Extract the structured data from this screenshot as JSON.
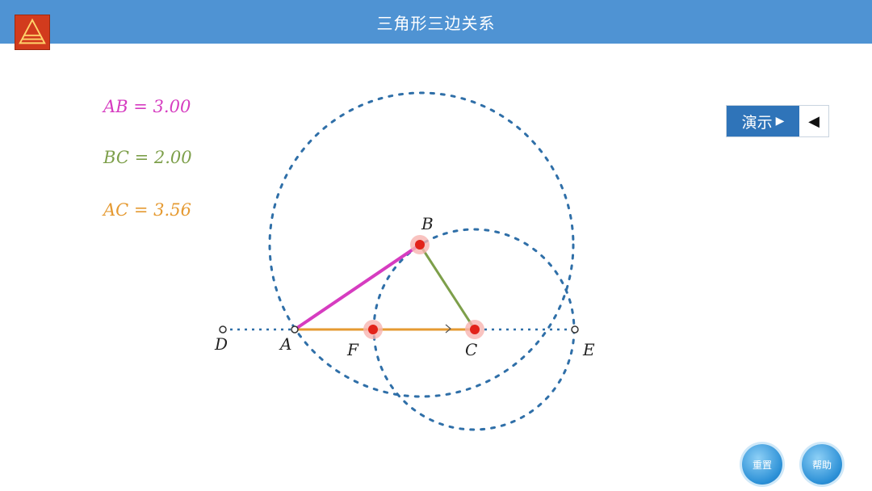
{
  "app": {
    "title": "三角形三边关系"
  },
  "colors": {
    "titlebar": "#4f93d3",
    "ab": "#d63cc0",
    "bc": "#7d9f4a",
    "ac": "#e59a32",
    "circle": "#2f6fa8",
    "point": "#e2231a"
  },
  "measurements": {
    "ab": "AB = 3.00",
    "bc": "BC = 2.00",
    "ac": "AC = 3.56"
  },
  "controls": {
    "demo_label": "演示",
    "demo_play_icon": "play-icon",
    "demo_back_icon": "triangle-left-icon",
    "back_symbol": "◀",
    "reset_label": "重置",
    "help_label": "帮助"
  },
  "points": {
    "A": "A",
    "B": "B",
    "C": "C",
    "D": "D",
    "E": "E",
    "F": "F"
  }
}
